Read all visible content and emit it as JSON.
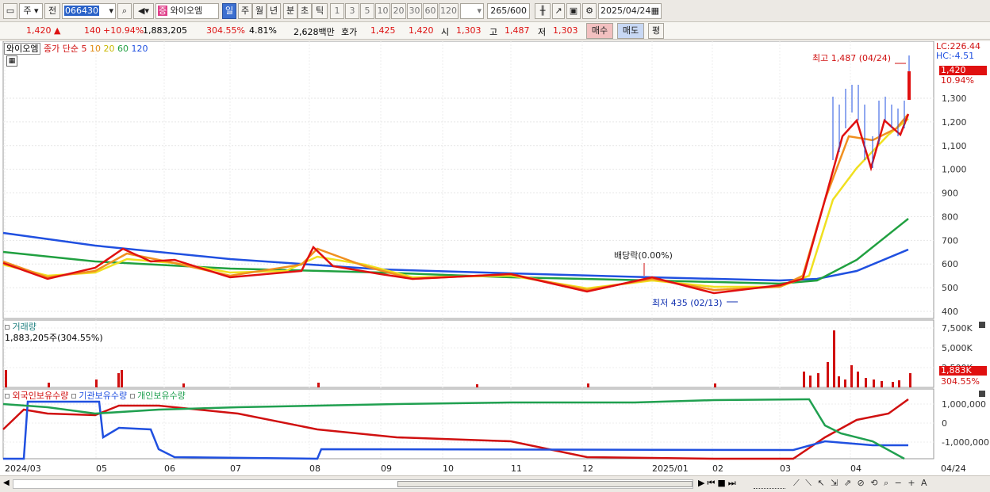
{
  "toolbar": {
    "market": "주",
    "prev_label": "전",
    "code": "066430",
    "name": "와이오엠",
    "name_badge": "증",
    "periods": [
      "일",
      "주",
      "월",
      "년",
      "분",
      "초",
      "틱"
    ],
    "minute_options": [
      "1",
      "3",
      "5",
      "10",
      "20",
      "30",
      "60",
      "120"
    ],
    "count": "265",
    "count_total": "/600",
    "date": "2025/04/24"
  },
  "quote": {
    "price": "1,420",
    "change_arrow": "▲",
    "change": "140",
    "change_pct": "+10.94%",
    "volume": "1,883,205",
    "volume_pct": "304.55%",
    "turnover": "4.81%",
    "amount": "2,628백만",
    "ask_label": "호가",
    "ask": "1,425",
    "bid": "1,420",
    "open_label": "시",
    "open": "1,303",
    "high_label": "고",
    "high": "1,487",
    "low_label": "저",
    "low": "1,303",
    "buy": "매수",
    "sell": "매도",
    "eval": "평"
  },
  "price_panel": {
    "legend_name": "와이오엠",
    "legend_title": "종가 단순",
    "ma_labels": [
      "5",
      "10",
      "20",
      "60",
      "120"
    ],
    "ma_colors": [
      "#e01010",
      "#f09020",
      "#f0e020",
      "#20a040",
      "#2050e0"
    ],
    "lc_label": "LC:226.44",
    "hc_label": "HC:-4.51",
    "last_price_tag": "1,420",
    "last_pct": "10.94%",
    "yticks": [
      "1,300",
      "1,200",
      "1,100",
      "1,000",
      "900",
      "800",
      "700",
      "600",
      "500",
      "400"
    ],
    "high_note": "최고 1,487 (04/24)",
    "low_note": "최저 435 (02/13)",
    "dividend_note": "배당락(0.00%)"
  },
  "volume_panel": {
    "title": "거래량",
    "value_text": "1,883,205주(304.55%)",
    "yticks": [
      "7,500K",
      "5,000K",
      "2,500K"
    ],
    "last_tag": "1,883K",
    "last_pct": "304.55%"
  },
  "holders_panel": {
    "legend": [
      "외국인보유수량",
      "기관보유수량",
      "개인보유수량"
    ],
    "legend_colors": [
      "#d01010",
      "#2050e0",
      "#20a050"
    ],
    "yticks": [
      "1,000,000",
      "0",
      "-1,000,000"
    ]
  },
  "xaxis": {
    "labels": [
      "2024/03",
      "05",
      "06",
      "07",
      "08",
      "09",
      "10",
      "11",
      "12",
      "2025/01",
      "02",
      "03",
      "04"
    ],
    "last_label": "04/24"
  }
}
